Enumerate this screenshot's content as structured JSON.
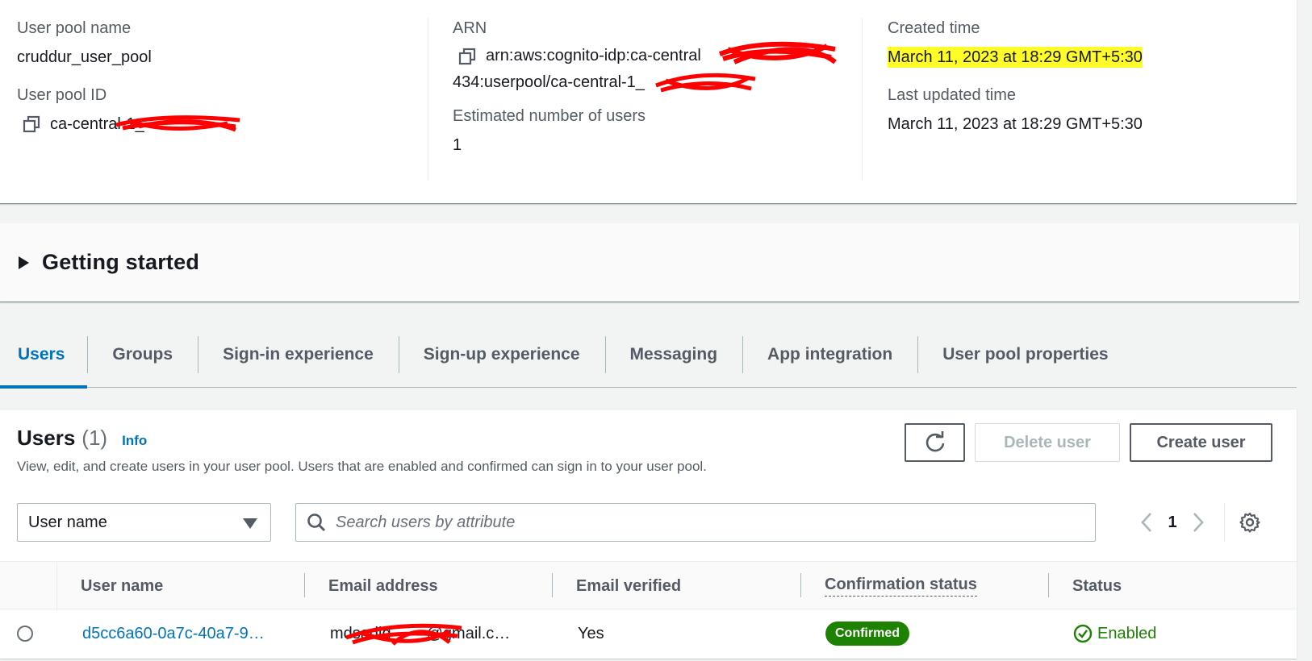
{
  "details": {
    "pool_name_label": "User pool name",
    "pool_name_value": "cruddur_user_pool",
    "pool_id_label": "User pool ID",
    "pool_id_value": "ca-central-1_",
    "arn_label": "ARN",
    "arn_line1": "arn:aws:cognito-idp:ca-central",
    "arn_line2": "434:userpool/ca-central-1_",
    "est_users_label": "Estimated number of users",
    "est_users_value": "1",
    "created_label": "Created time",
    "created_value": "March 11, 2023 at 18:29 GMT+5:30",
    "updated_label": "Last updated time",
    "updated_value": "March 11, 2023 at 18:29 GMT+5:30"
  },
  "getting_started": {
    "title": "Getting started"
  },
  "tabs": [
    {
      "label": "Users",
      "active": true
    },
    {
      "label": "Groups"
    },
    {
      "label": "Sign-in experience"
    },
    {
      "label": "Sign-up experience"
    },
    {
      "label": "Messaging"
    },
    {
      "label": "App integration"
    },
    {
      "label": "User pool properties"
    }
  ],
  "users_panel": {
    "title": "Users",
    "count": "(1)",
    "info": "Info",
    "description": "View, edit, and create users in your user pool. Users that are enabled and confirmed can sign in to your user pool.",
    "delete_label": "Delete user",
    "create_label": "Create user",
    "filter_selected": "User name",
    "search_placeholder": "Search users by attribute",
    "page": "1"
  },
  "table": {
    "columns": [
      "User name",
      "Email address",
      "Email verified",
      "Confirmation status",
      "Status"
    ],
    "rows": [
      {
        "user_name": "d5cc6a60-0a7c-40a7-9…",
        "email_start": "mdsadiq",
        "email_end": "@gmail.c…",
        "email_verified": "Yes",
        "confirmation_status": "Confirmed",
        "status": "Enabled"
      }
    ]
  },
  "colors": {
    "accent": "#0073bb",
    "success": "#1d8102",
    "highlight": "#fffc27",
    "redaction": "#ff0000"
  },
  "icons": [
    "copy-icon",
    "caret-right-icon",
    "refresh-icon",
    "caret-down-icon",
    "search-icon",
    "chevron-left-icon",
    "chevron-right-icon",
    "settings-gear-icon",
    "check-circle-icon"
  ]
}
